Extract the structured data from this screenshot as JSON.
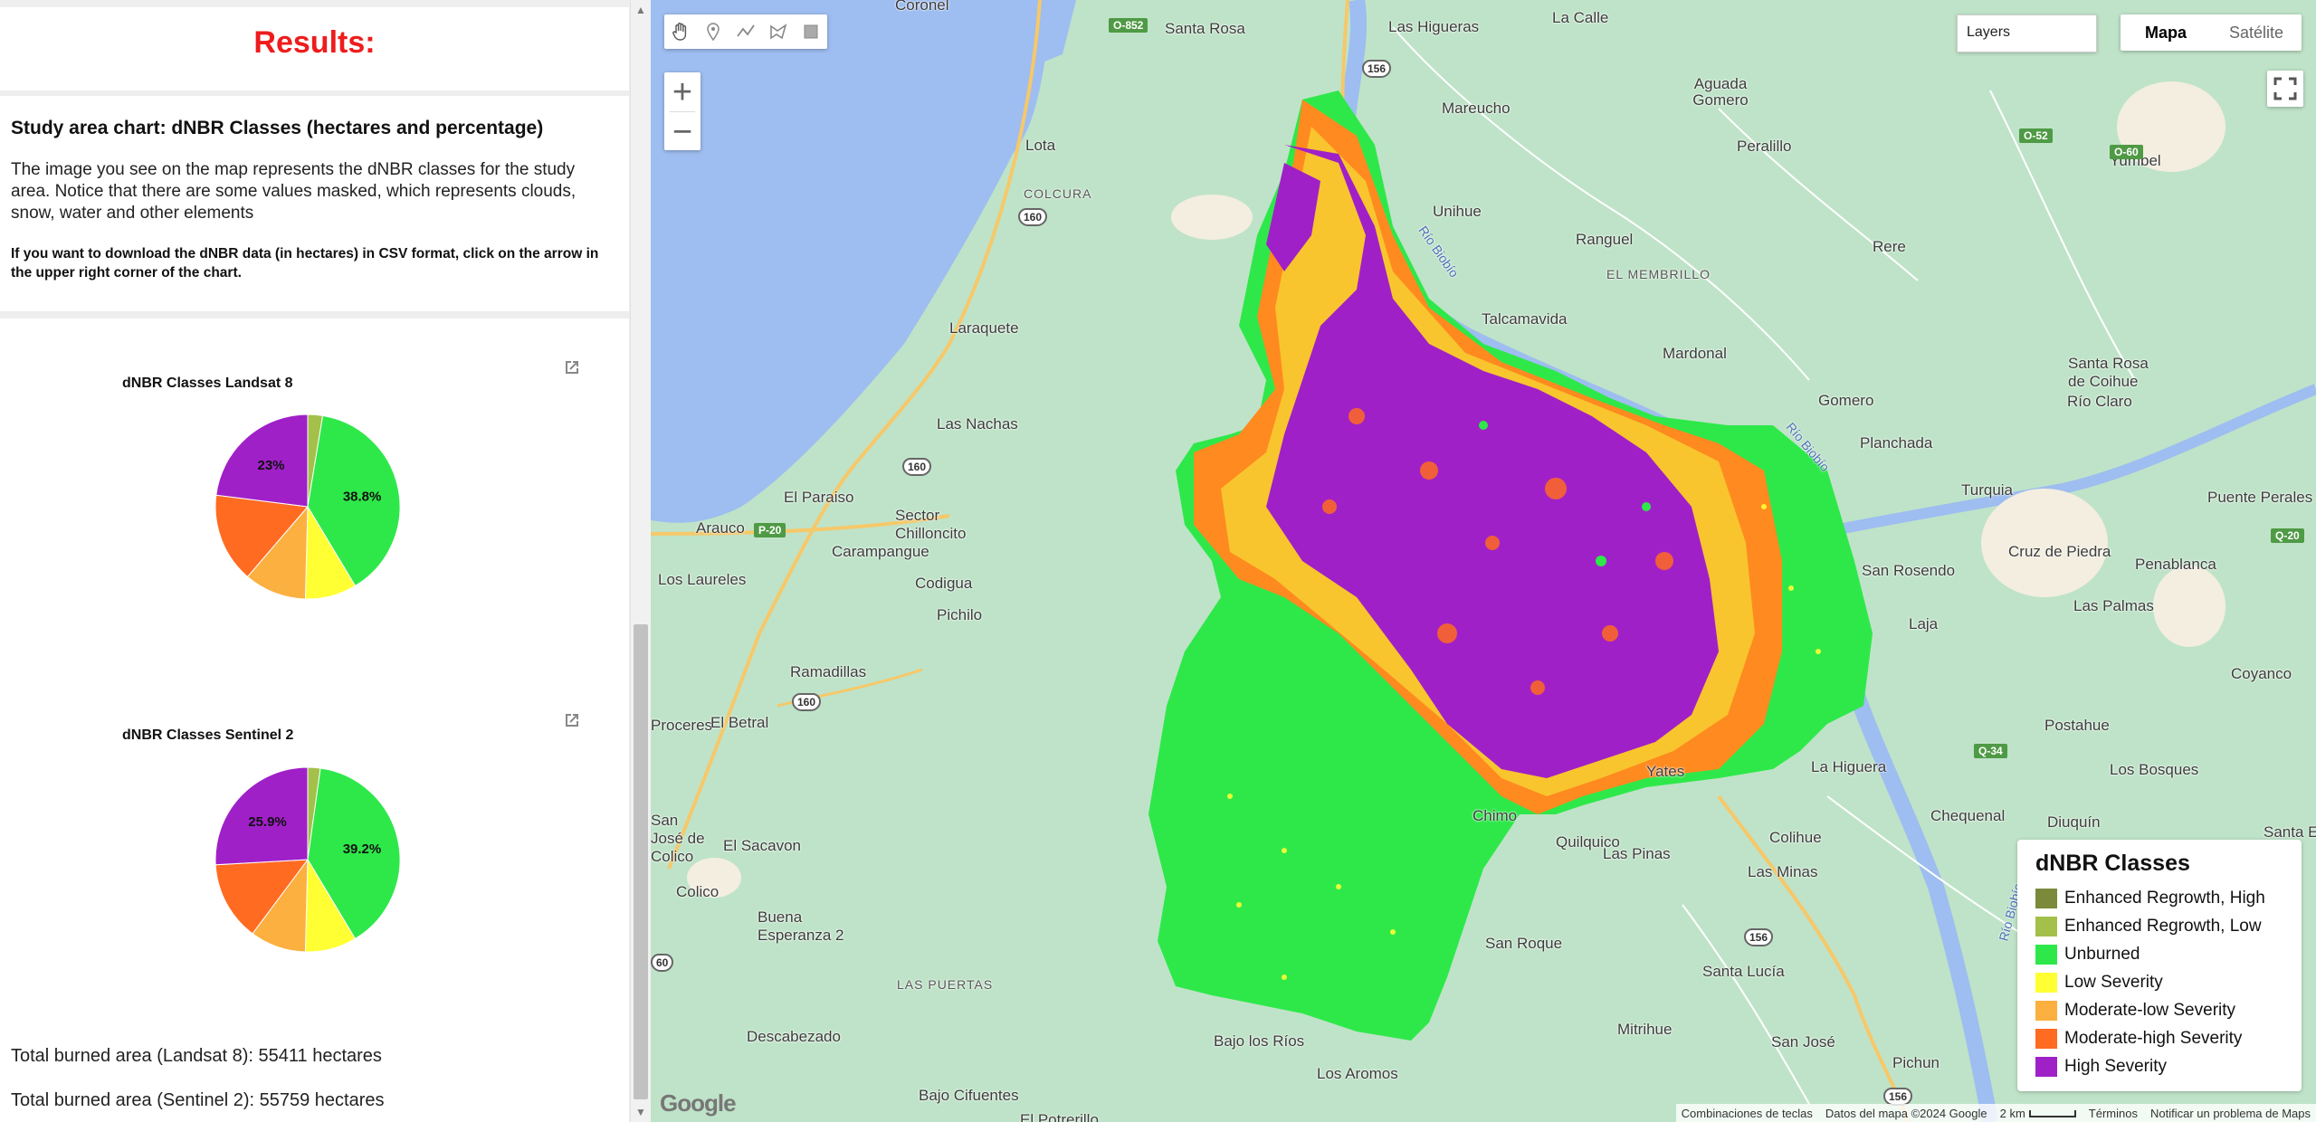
{
  "results_title": "Results:",
  "study": {
    "heading": "Study area chart: dNBR Classes (hectares and percentage)",
    "description": "The image you see on the map represents the dNBR classes for the study area. Notice that there are some values masked, which represents clouds, snow, water and other elements",
    "download_note": "If you want to download the dNBR data (in hectares) in CSV format, click on the arrow in the upper right corner of the chart."
  },
  "chart_data": [
    {
      "type": "pie",
      "title": "dNBR Classes Landsat 8",
      "categories": [
        "Enhanced Regrowth, Low",
        "Unburned",
        "Low Severity",
        "Moderate-low Severity",
        "Moderate-high Severity",
        "High Severity"
      ],
      "values": [
        2.6,
        38.8,
        9.0,
        10.9,
        15.7,
        23.0
      ],
      "data_labels": [
        "",
        "38.8%",
        "",
        "",
        "",
        "23%"
      ],
      "colors": [
        "#a3c04a",
        "#2ee84a",
        "#ffff33",
        "#fbb040",
        "#ff6b21",
        "#a020c8"
      ]
    },
    {
      "type": "pie",
      "title": "dNBR Classes Sentinel 2",
      "categories": [
        "Enhanced Regrowth, Low",
        "Unburned",
        "Low Severity",
        "Moderate-low Severity",
        "Moderate-high Severity",
        "High Severity"
      ],
      "values": [
        2.2,
        39.2,
        9.0,
        9.8,
        13.9,
        25.9
      ],
      "data_labels": [
        "",
        "39.2%",
        "",
        "",
        "",
        "25.9%"
      ],
      "colors": [
        "#a3c04a",
        "#2ee84a",
        "#ffff33",
        "#fbb040",
        "#ff6b21",
        "#a020c8"
      ]
    }
  ],
  "totals": {
    "landsat": "Total burned area (Landsat 8): 55411 hectares",
    "sentinel": "Total burned area (Sentinel 2): 55759 hectares"
  },
  "map": {
    "layers_label": "Layers",
    "map_type": {
      "map": "Mapa",
      "satellite": "Satélite"
    },
    "zoom_in": "+",
    "zoom_out": "−",
    "legend": {
      "title": "dNBR Classes",
      "items": [
        {
          "label": "Enhanced Regrowth, High",
          "color": "#7a8a3a"
        },
        {
          "label": "Enhanced Regrowth, Low",
          "color": "#a3c04a"
        },
        {
          "label": "Unburned",
          "color": "#2ee84a"
        },
        {
          "label": "Low Severity",
          "color": "#ffff33"
        },
        {
          "label": "Moderate-low Severity",
          "color": "#fbb040"
        },
        {
          "label": "Moderate-high Severity",
          "color": "#ff6b21"
        },
        {
          "label": "High Severity",
          "color": "#a020c8"
        }
      ]
    },
    "places": [
      "Coronel",
      "Santa Rosa",
      "Las Higueras",
      "La Calle",
      "Lota",
      "COLCURA",
      "Mareucho",
      "Aguada Gomero",
      "Peralillo",
      "Yumbel",
      "Unihue",
      "Ranguel",
      "EL MEMBRILLO",
      "Rere",
      "Laraquete",
      "Talcamavida",
      "Mardonal",
      "Las Nachas",
      "Gomero",
      "Santa Rosa de Coihue",
      "Río Claro",
      "Planchada",
      "El Paraiso",
      "Turquia",
      "Puente Perales",
      "Arauco",
      "Sector Chilloncito",
      "Carampangue",
      "San Rosendo",
      "Cruz de Piedra",
      "Penablanca",
      "Los Laureles",
      "Codigua",
      "Las Palmas",
      "Pichilo",
      "Laja",
      "Ramadillas",
      "Coyanco",
      "Proceres",
      "El Betral",
      "Postahue",
      "Yates",
      "La Higuera",
      "Los Bosques",
      "San José de Colico",
      "Chequenal",
      "Diuquín",
      "Santa Ele",
      "Quilquico",
      "Colihue",
      "El Sacavon",
      "Las Pinas",
      "Las Minas",
      "Colico",
      "Buena Esperanza 2",
      "San Roque",
      "Santa Lucía",
      "LAS PUERTAS",
      "Descabezado",
      "Mitrihue",
      "Bajo los Ríos",
      "San José",
      "Los Aromos",
      "Pichun",
      "Bajo Cifuentes",
      "El Potrerillo",
      "Chimo"
    ],
    "rivers": [
      "Río Biobío",
      "Río Biobío",
      "Río Biobío"
    ],
    "shields": [
      "156",
      "160",
      "160",
      "160",
      "60",
      "156",
      "156"
    ],
    "highways": [
      "O-852",
      "P-20",
      "O-52",
      "O-60",
      "Q-20",
      "Q-34"
    ],
    "footer": {
      "logo": "Google",
      "shortcuts": "Combinaciones de teclas",
      "map_data": "Datos del mapa ©2024 Google",
      "scale": "2 km",
      "terms": "Términos",
      "report": "Notificar un problema de Maps"
    }
  }
}
